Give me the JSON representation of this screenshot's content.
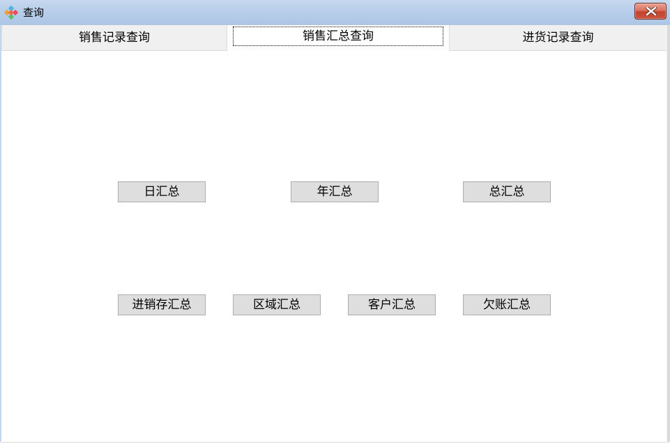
{
  "window": {
    "title": "查询",
    "app_icon": "colorful-diamond-icon",
    "close_icon": "close-icon",
    "colors": {
      "titlebar": "#b6cde9",
      "close_button": "#c9553e",
      "tab_inactive": "#f0f0f0",
      "button_face": "#dedede",
      "button_border": "#adadad"
    }
  },
  "tabs": [
    {
      "label": "销售记录查询",
      "selected": false
    },
    {
      "label": "销售汇总查询",
      "selected": true
    },
    {
      "label": "进货记录查询",
      "selected": false
    }
  ],
  "buttons": {
    "row1": [
      {
        "label": "日汇总"
      },
      {
        "label": "年汇总"
      },
      {
        "label": "总汇总"
      }
    ],
    "row2": [
      {
        "label": "进销存汇总"
      },
      {
        "label": "区域汇总"
      },
      {
        "label": "客户汇总"
      },
      {
        "label": "欠账汇总"
      }
    ]
  }
}
